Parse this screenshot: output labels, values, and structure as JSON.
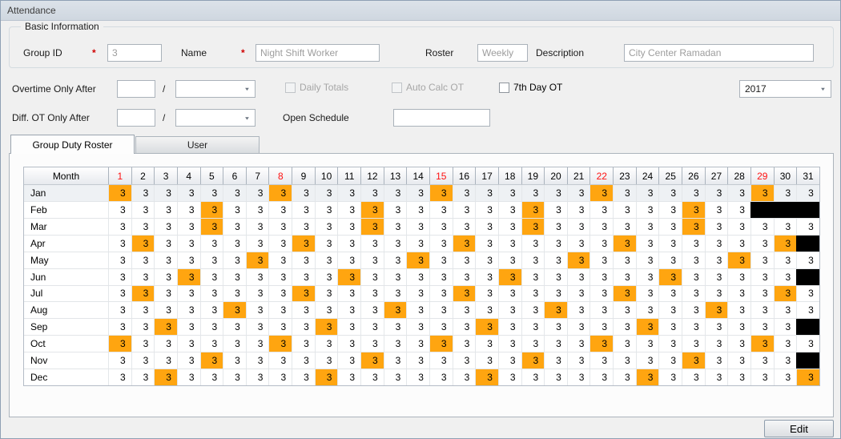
{
  "window": {
    "title": "Attendance"
  },
  "basic_info": {
    "legend": "Basic Information",
    "required_marker": "*",
    "group_id": {
      "label": "Group ID",
      "value": "3"
    },
    "name": {
      "label": "Name",
      "value": "Night Shift Worker"
    },
    "roster": {
      "label": "Roster",
      "value": "Weekly"
    },
    "description": {
      "label": "Description",
      "value": "City Center Ramadan"
    }
  },
  "controls": {
    "overtime_only_after": {
      "label": "Overtime Only After",
      "hours_value": "",
      "unit_value": ""
    },
    "diff_ot_only_after": {
      "label": "Diff. OT Only After",
      "hours_value": "",
      "unit_value": ""
    },
    "slash": "/",
    "daily_totals": {
      "label": "Daily Totals",
      "enabled": false,
      "checked": false
    },
    "auto_calc_ot": {
      "label": "Auto Calc OT",
      "enabled": false,
      "checked": false
    },
    "seventh_day_ot": {
      "label": "7th Day OT",
      "enabled": true,
      "checked": false
    },
    "open_schedule": {
      "label": "Open Schedule",
      "value": ""
    },
    "year_select": {
      "value": "2017"
    }
  },
  "tabs": [
    {
      "label": "Group Duty Roster",
      "active": true
    },
    {
      "label": "User",
      "active": false
    }
  ],
  "roster_table": {
    "month_header": "Month",
    "day_headers": [
      1,
      2,
      3,
      4,
      5,
      6,
      7,
      8,
      9,
      10,
      11,
      12,
      13,
      14,
      15,
      16,
      17,
      18,
      19,
      20,
      21,
      22,
      23,
      24,
      25,
      26,
      27,
      28,
      29,
      30,
      31
    ],
    "sunday_columns": [
      1,
      8,
      15,
      22,
      29
    ],
    "shift_value": "3",
    "highlight_color": "#FFA510",
    "invalid_day_color": "#000000",
    "sunday_header_color": "#FF1111",
    "rows": [
      {
        "month": "Jan",
        "days_in_month": 31,
        "highlighted": [
          1,
          8,
          15,
          22,
          29
        ],
        "selected": true
      },
      {
        "month": "Feb",
        "days_in_month": 28,
        "highlighted": [
          5,
          12,
          19,
          26
        ],
        "selected": false
      },
      {
        "month": "Mar",
        "days_in_month": 31,
        "highlighted": [
          5,
          12,
          19,
          26
        ],
        "selected": false
      },
      {
        "month": "Apr",
        "days_in_month": 30,
        "highlighted": [
          2,
          9,
          16,
          23,
          30
        ],
        "selected": false
      },
      {
        "month": "May",
        "days_in_month": 31,
        "highlighted": [
          7,
          14,
          21,
          28
        ],
        "selected": false
      },
      {
        "month": "Jun",
        "days_in_month": 30,
        "highlighted": [
          4,
          11,
          18,
          25
        ],
        "selected": false
      },
      {
        "month": "Jul",
        "days_in_month": 31,
        "highlighted": [
          2,
          9,
          16,
          23,
          30
        ],
        "selected": false
      },
      {
        "month": "Aug",
        "days_in_month": 31,
        "highlighted": [
          6,
          13,
          20,
          27
        ],
        "selected": false
      },
      {
        "month": "Sep",
        "days_in_month": 30,
        "highlighted": [
          3,
          10,
          17,
          24
        ],
        "selected": false
      },
      {
        "month": "Oct",
        "days_in_month": 31,
        "highlighted": [
          1,
          8,
          15,
          22,
          29
        ],
        "selected": false
      },
      {
        "month": "Nov",
        "days_in_month": 30,
        "highlighted": [
          5,
          12,
          19,
          26
        ],
        "selected": false
      },
      {
        "month": "Dec",
        "days_in_month": 31,
        "highlighted": [
          3,
          10,
          17,
          24,
          31
        ],
        "selected": false
      }
    ]
  },
  "footer": {
    "edit_label": "Edit"
  }
}
